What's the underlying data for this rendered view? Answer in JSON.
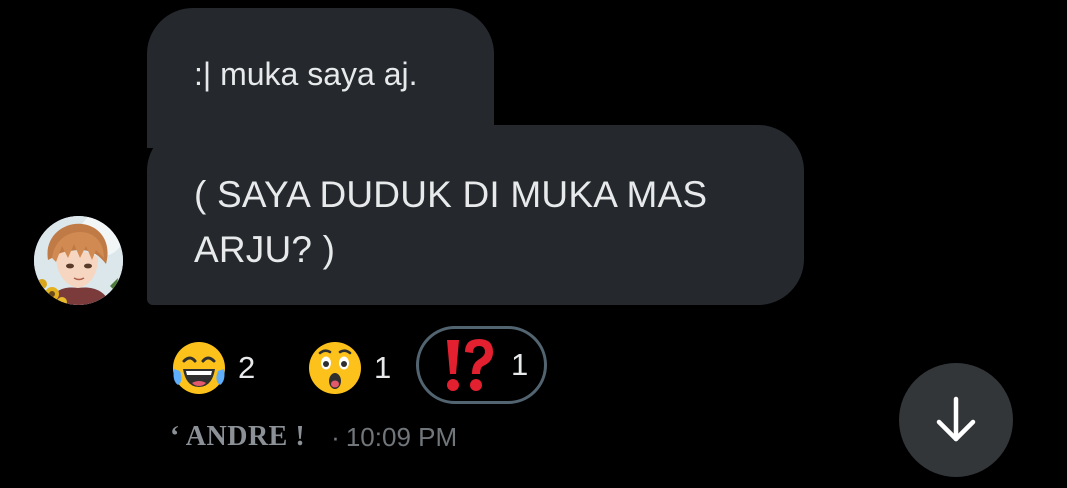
{
  "messages": [
    {
      "text": ":| muka saya aj."
    },
    {
      "text": "( SAYA DUDUK DI MUKA MAS ARJU? )"
    }
  ],
  "avatar": {
    "icon": "anime-avatar-icon"
  },
  "reactions": [
    {
      "emoji": "😂",
      "icon": "laughing-tears-emoji-icon",
      "count": "2"
    },
    {
      "emoji": "😲",
      "icon": "astonished-face-emoji-icon",
      "count": "1"
    },
    {
      "emoji": "⁉️",
      "icon": "exclamation-question-emoji-icon",
      "count": "1",
      "selected": true
    }
  ],
  "meta": {
    "sender": "‘ ANDRE !",
    "separator": "·",
    "time": "10:09 PM"
  },
  "scroll_button": {
    "icon": "arrow-down-icon"
  },
  "colors": {
    "background": "#000000",
    "bubble": "#25292e",
    "text": "#e7e9ea",
    "muted": "#71767b",
    "selected_border": "#536471",
    "scroll_button": "#333639"
  }
}
